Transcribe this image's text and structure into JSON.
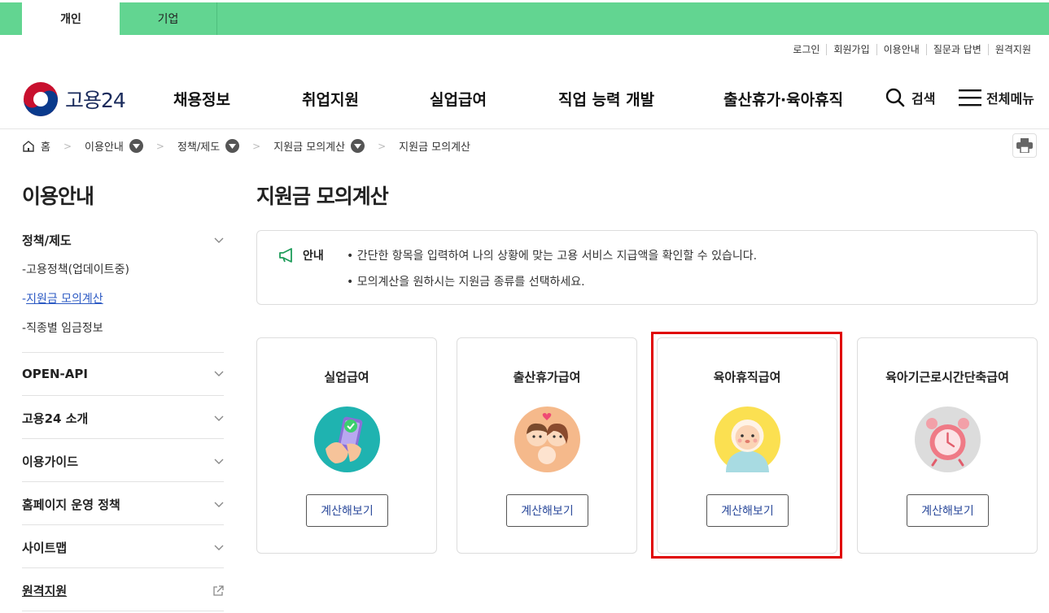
{
  "top_tabs": [
    "개인",
    "기업"
  ],
  "util_links": [
    "로그인",
    "회원가입",
    "이용안내",
    "질문과 답변",
    "원격지원"
  ],
  "logo_text": "고용24",
  "gnb": [
    "채용정보",
    "취업지원",
    "실업급여",
    "직업 능력 개발",
    "출산휴가·육아휴직"
  ],
  "search_label": "검색",
  "menu_label": "전체메뉴",
  "breadcrumb": [
    "홈",
    "이용안내",
    "정책/제도",
    "지원금 모의계산",
    "지원금 모의계산"
  ],
  "lnb": {
    "title": "이용안내",
    "sections": [
      "정책/제도",
      "OPEN-API",
      "고용24 소개",
      "이용가이드",
      "홈페이지 운영 정책",
      "사이트맵",
      "원격지원"
    ],
    "sub_items": [
      "고용정책(업데이트중)",
      "지원금 모의계산",
      "직종별 임금정보"
    ]
  },
  "page_title": "지원금 모의계산",
  "notice": {
    "label": "안내",
    "lines": [
      "간단한 항목을 입력하여 나의 상황에 맞는 고용 서비스 지급액을 확인할 수 있습니다.",
      "모의계산을 원하시는 지원금 종류를 선택하세요."
    ]
  },
  "cards": [
    {
      "title": "실업급여",
      "button": "계산해보기"
    },
    {
      "title": "출산휴가급여",
      "button": "계산해보기"
    },
    {
      "title": "육아휴직급여",
      "button": "계산해보기"
    },
    {
      "title": "육아기근로시간단축급여",
      "button": "계산해보기"
    }
  ],
  "colors": {
    "topbar": "#62d591",
    "highlight": "#e00000",
    "link": "#2b59c3"
  }
}
